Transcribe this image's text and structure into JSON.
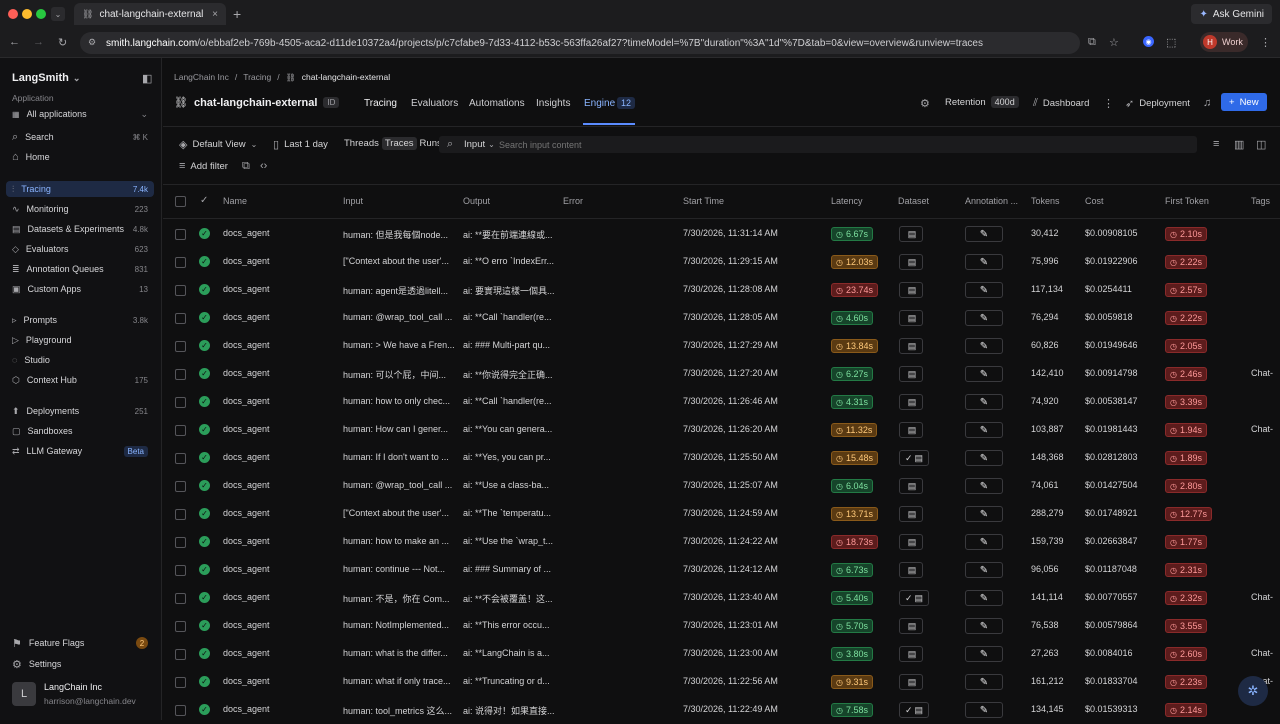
{
  "browser": {
    "tab_title": "chat-langchain-external - La",
    "url_host": "smith.langchain.com",
    "url_rest": "/o/ebbaf2eb-769b-4505-aca2-d11de10372a4/projects/p/c7cfabe9-7d33-4112-b53c-563ffa26af27?timeModel=%7B\"duration\"%3A\"1d\"%7D&tab=0&view=overview&runview=traces",
    "ask_gemini": "Ask Gemini",
    "profile_initial": "H",
    "profile_label": "Work"
  },
  "sidebar": {
    "app_name": "LangSmith",
    "section_label": "Application",
    "app_selector": "All applications",
    "search_label": "Search",
    "search_shortcut": "⌘ K",
    "home_label": "Home",
    "items": [
      {
        "label": "Tracing",
        "count": "7.4k"
      },
      {
        "label": "Monitoring",
        "count": "223"
      },
      {
        "label": "Datasets & Experiments",
        "count": "4.8k"
      },
      {
        "label": "Evaluators",
        "count": "623"
      },
      {
        "label": "Annotation Queues",
        "count": "831"
      },
      {
        "label": "Custom Apps",
        "count": "13"
      },
      {
        "label": "Prompts",
        "count": "3.8k"
      },
      {
        "label": "Playground",
        "count": ""
      },
      {
        "label": "Studio",
        "count": ""
      },
      {
        "label": "Context Hub",
        "count": "175"
      },
      {
        "label": "Deployments",
        "count": "251"
      },
      {
        "label": "Sandboxes",
        "count": ""
      },
      {
        "label": "LLM Gateway",
        "count": "Beta"
      }
    ],
    "feature_flags": "Feature Flags",
    "feature_flags_count": "2",
    "settings": "Settings",
    "org_name": "LangChain Inc",
    "user_email": "harrison@langchain.dev",
    "avatar_letter": "L"
  },
  "breadcrumb": {
    "org": "LangChain Inc",
    "section": "Tracing",
    "project": "chat-langchain-external"
  },
  "project": {
    "title": "chat-langchain-external",
    "id_label": "ID",
    "tabs": [
      "Tracing",
      "Evaluators",
      "Automations",
      "Insights",
      "Engine"
    ],
    "engine_count": "12",
    "retention_label": "Retention",
    "retention_value": "400d",
    "dashboard": "Dashboard",
    "deployment": "Deployment",
    "new": "New"
  },
  "toolbar": {
    "view": "Default View",
    "time": "Last 1 day",
    "seg": [
      "Threads",
      "Traces",
      "Runs"
    ],
    "input_filter": "Input",
    "search_placeholder": "Search input content",
    "add_filter": "Add filter"
  },
  "columns": [
    "Name",
    "Input",
    "Output",
    "Error",
    "Start Time",
    "Latency",
    "Dataset",
    "Annotation ...",
    "Tokens",
    "Cost",
    "First Token",
    "Tags"
  ],
  "rows": [
    {
      "name": "docs_agent",
      "input": "human: 但是我每個node...",
      "output": "ai: **要在前端連線或...",
      "start": "7/30/2026, 11:31:14 AM",
      "latency": "6.67s",
      "lc": "g",
      "ds": "",
      "tokens": "30,412",
      "cost": "$0.00908105",
      "ft": "2.10s",
      "tag": ""
    },
    {
      "name": "docs_agent",
      "input": "[\"Context about the user'...",
      "output": "ai: **O erro `IndexErr...",
      "start": "7/30/2026, 11:29:15 AM",
      "latency": "12.03s",
      "lc": "o",
      "ds": "",
      "tokens": "75,996",
      "cost": "$0.01922906",
      "ft": "2.22s",
      "tag": ""
    },
    {
      "name": "docs_agent",
      "input": "human: agent是透過litell...",
      "output": "ai: 要實現這樣一個具...",
      "start": "7/30/2026, 11:28:08 AM",
      "latency": "23.74s",
      "lc": "r",
      "ds": "",
      "tokens": "117,134",
      "cost": "$0.0254411",
      "ft": "2.57s",
      "tag": ""
    },
    {
      "name": "docs_agent",
      "input": "human: @wrap_tool_call ...",
      "output": "ai: **Call `handler(re...",
      "start": "7/30/2026, 11:28:05 AM",
      "latency": "4.60s",
      "lc": "g",
      "ds": "",
      "tokens": "76,294",
      "cost": "$0.0059818",
      "ft": "2.22s",
      "tag": ""
    },
    {
      "name": "docs_agent",
      "input": "human: > We have a Fren...",
      "output": "ai: ### Multi-part qu...",
      "start": "7/30/2026, 11:27:29 AM",
      "latency": "13.84s",
      "lc": "o",
      "ds": "",
      "tokens": "60,826",
      "cost": "$0.01949646",
      "ft": "2.05s",
      "tag": ""
    },
    {
      "name": "docs_agent",
      "input": "human: 可以个屁，中间...",
      "output": "ai: **你说得完全正确...",
      "start": "7/30/2026, 11:27:20 AM",
      "latency": "6.27s",
      "lc": "g",
      "ds": "",
      "tokens": "142,410",
      "cost": "$0.00914798",
      "ft": "2.46s",
      "tag": "Chat-"
    },
    {
      "name": "docs_agent",
      "input": "human: how to only chec...",
      "output": "ai: **Call `handler(re...",
      "start": "7/30/2026, 11:26:46 AM",
      "latency": "4.31s",
      "lc": "g",
      "ds": "",
      "tokens": "74,920",
      "cost": "$0.00538147",
      "ft": "3.39s",
      "tag": ""
    },
    {
      "name": "docs_agent",
      "input": "human: How can I gener...",
      "output": "ai: **You can genera...",
      "start": "7/30/2026, 11:26:20 AM",
      "latency": "11.32s",
      "lc": "o",
      "ds": "",
      "tokens": "103,887",
      "cost": "$0.01981443",
      "ft": "1.94s",
      "tag": "Chat-"
    },
    {
      "name": "docs_agent",
      "input": "human: If I don't want to ...",
      "output": "ai: **Yes, you can pr...",
      "start": "7/30/2026, 11:25:50 AM",
      "latency": "15.48s",
      "lc": "o",
      "ds": "✓",
      "tokens": "148,368",
      "cost": "$0.02812803",
      "ft": "1.89s",
      "tag": ""
    },
    {
      "name": "docs_agent",
      "input": "human: @wrap_tool_call ...",
      "output": "ai: **Use a class-ba...",
      "start": "7/30/2026, 11:25:07 AM",
      "latency": "6.04s",
      "lc": "g",
      "ds": "",
      "tokens": "74,061",
      "cost": "$0.01427504",
      "ft": "2.80s",
      "tag": ""
    },
    {
      "name": "docs_agent",
      "input": "[\"Context about the user'...",
      "output": "ai: **The `temperatu...",
      "start": "7/30/2026, 11:24:59 AM",
      "latency": "13.71s",
      "lc": "o",
      "ds": "",
      "tokens": "288,279",
      "cost": "$0.01748921",
      "ft": "12.77s",
      "tag": ""
    },
    {
      "name": "docs_agent",
      "input": "human: how to make an ...",
      "output": "ai: **Use the `wrap_t...",
      "start": "7/30/2026, 11:24:22 AM",
      "latency": "18.73s",
      "lc": "r",
      "ds": "",
      "tokens": "159,739",
      "cost": "$0.02663847",
      "ft": "1.77s",
      "tag": ""
    },
    {
      "name": "docs_agent",
      "input": "human: continue --- Not...",
      "output": "ai: ### Summary of ...",
      "start": "7/30/2026, 11:24:12 AM",
      "latency": "6.73s",
      "lc": "g",
      "ds": "",
      "tokens": "96,056",
      "cost": "$0.01187048",
      "ft": "2.31s",
      "tag": ""
    },
    {
      "name": "docs_agent",
      "input": "human: 不是，你在 Com...",
      "output": "ai: **不会被覆盖！这...",
      "start": "7/30/2026, 11:23:40 AM",
      "latency": "5.40s",
      "lc": "g",
      "ds": "✓",
      "tokens": "141,114",
      "cost": "$0.00770557",
      "ft": "2.32s",
      "tag": "Chat-"
    },
    {
      "name": "docs_agent",
      "input": "human: NotImplemented...",
      "output": "ai: **This error occu...",
      "start": "7/30/2026, 11:23:01 AM",
      "latency": "5.70s",
      "lc": "g",
      "ds": "",
      "tokens": "76,538",
      "cost": "$0.00579864",
      "ft": "3.55s",
      "tag": ""
    },
    {
      "name": "docs_agent",
      "input": "human: what is the differ...",
      "output": "ai: **LangChain is a...",
      "start": "7/30/2026, 11:23:00 AM",
      "latency": "3.80s",
      "lc": "g",
      "ds": "",
      "tokens": "27,263",
      "cost": "$0.0084016",
      "ft": "2.60s",
      "tag": "Chat-"
    },
    {
      "name": "docs_agent",
      "input": "human: what if only trace...",
      "output": "ai: **Truncating or d...",
      "start": "7/30/2026, 11:22:56 AM",
      "latency": "9.31s",
      "lc": "o",
      "ds": "",
      "tokens": "161,212",
      "cost": "$0.01833704",
      "ft": "2.23s",
      "tag": "Chat-"
    },
    {
      "name": "docs_agent",
      "input": "human: tool_metrics 这么...",
      "output": "ai: 说得对！如果直接...",
      "start": "7/30/2026, 11:22:49 AM",
      "latency": "7.58s",
      "lc": "g",
      "ds": "✓",
      "tokens": "134,145",
      "cost": "$0.01539313",
      "ft": "2.14s",
      "tag": ""
    }
  ]
}
